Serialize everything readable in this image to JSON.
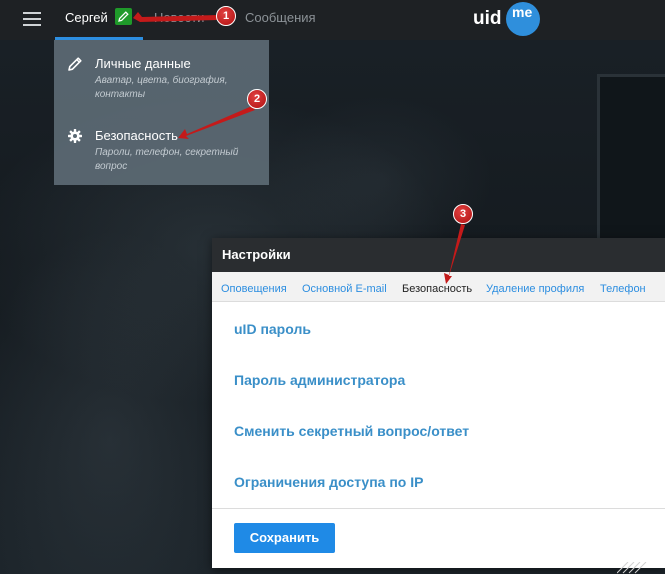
{
  "topbar": {
    "user_name": "Сергей",
    "nav_news": "Новости",
    "nav_messages": "Сообщения",
    "logo_left": "uid",
    "logo_right": "me"
  },
  "dropdown": {
    "items": [
      {
        "title": "Личные данные",
        "description": "Аватар, цвета, биография, контакты",
        "icon": "pencil-icon"
      },
      {
        "title": "Безопасность",
        "description": "Пароли, телефон, секретный вопрос",
        "icon": "gear-icon"
      }
    ]
  },
  "settings": {
    "title": "Настройки",
    "tabs": [
      {
        "label": "Оповещения",
        "active": false
      },
      {
        "label": "Основной E-mail",
        "active": false
      },
      {
        "label": "Безопасность",
        "active": true
      },
      {
        "label": "Удаление профиля",
        "active": false
      },
      {
        "label": "Телефон",
        "active": false
      }
    ],
    "options": [
      "uID пароль",
      "Пароль администратора",
      "Сменить секретный вопрос/ответ",
      "Ограничения доступа по IP"
    ],
    "save_label": "Сохранить"
  },
  "callouts": [
    "1",
    "2",
    "3"
  ],
  "colors": {
    "accent": "#2d8ee0",
    "save_button": "#1f8ae6",
    "edit_badge": "#1f9a2a",
    "callout": "#c41a1a",
    "link_option": "#3a8fc8"
  }
}
